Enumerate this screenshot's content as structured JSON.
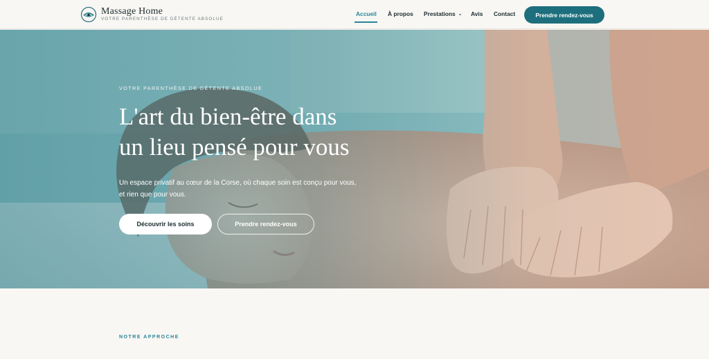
{
  "brand": {
    "name": "Massage Home",
    "tagline": "VOTRE PARENTHÈSE DE DÉTENTE ABSOLUE"
  },
  "nav": {
    "items": [
      {
        "label": "Accueil",
        "active": true
      },
      {
        "label": "À propos"
      },
      {
        "label": "Prestations",
        "has_dropdown": true
      },
      {
        "label": "Avis"
      },
      {
        "label": "Contact"
      }
    ],
    "cta": "Prendre rendez-vous"
  },
  "hero": {
    "eyebrow": "VOTRE PARENTHÈSE DE DÉTENTE ABSOLUE",
    "title_line1": "L'art du bien-être dans",
    "title_line2": "un lieu pensé pour vous",
    "text_line1": "Un espace privatif au cœur de la Corse, où chaque soin est conçu pour vous,",
    "text_line2": "et rien que pour vous.",
    "primary_button": "Découvrir les soins",
    "secondary_button": "Prendre rendez-vous"
  },
  "section": {
    "label": "NOTRE APPROCHE"
  },
  "colors": {
    "accent": "#2a8596",
    "cta": "#1e6f7d",
    "background": "#f8f7f4"
  }
}
